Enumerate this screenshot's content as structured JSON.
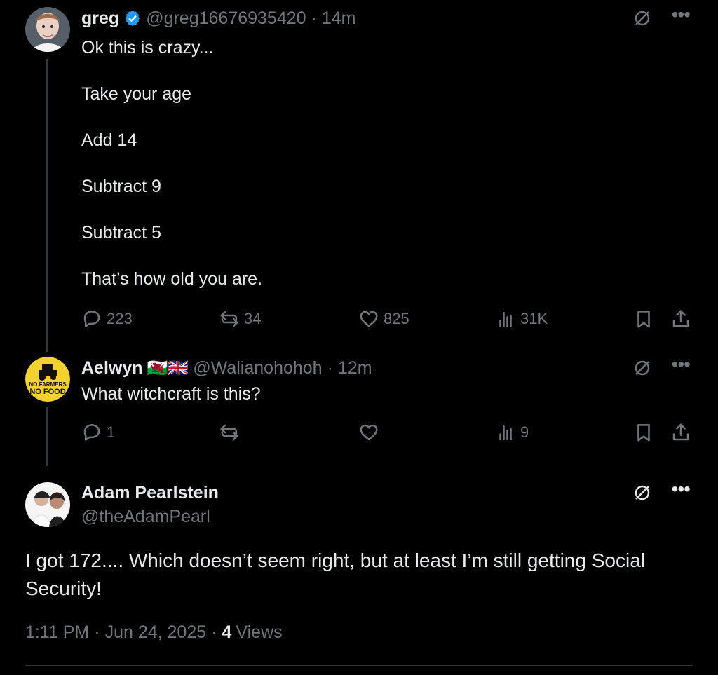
{
  "colors": {
    "background": "#000000",
    "text_primary": "#e7e9ea",
    "text_secondary": "#71767b",
    "verified_blue": "#1d9bf0",
    "divider": "#2f3336"
  },
  "tweets": [
    {
      "display_name": "greg",
      "verified": true,
      "handle": "@greg16676935420",
      "separator": "·",
      "time": "14m",
      "lines": [
        "Ok this is crazy...",
        "",
        "Take your age",
        "",
        "Add 14",
        "",
        "Subtract 9",
        "",
        "Subtract 5",
        "",
        "That’s how old you are."
      ],
      "stats": {
        "replies": "223",
        "reposts": "34",
        "likes": "825",
        "views": "31K"
      },
      "icons": {
        "reply": "reply-icon",
        "repost": "repost-icon",
        "like": "heart-icon",
        "views": "analytics-icon",
        "bookmark": "bookmark-icon",
        "share": "share-icon"
      }
    },
    {
      "display_name": "Aelwyn",
      "flags": "🏴󠁧󠁢󠁷󠁬󠁳󠁿🇬🇧",
      "handle": "@Walianohohoh",
      "separator": "·",
      "time": "12m",
      "lines": [
        "What witchcraft is this?"
      ],
      "avatar_text": {
        "line1": "NO FARMERS",
        "line2": "NO FOOD"
      },
      "stats": {
        "replies": "1",
        "reposts": "",
        "likes": "",
        "views": "9"
      }
    }
  ],
  "main_post": {
    "display_name": "Adam Pearlstein",
    "handle": "@theAdamPearl",
    "text": "I got 172.... Which doesn’t seem right, but at least I’m still getting Social Security!",
    "time": "1:11 PM",
    "date": "Jun 24, 2025",
    "separator": "·",
    "views_count": "4",
    "views_label": "Views"
  }
}
